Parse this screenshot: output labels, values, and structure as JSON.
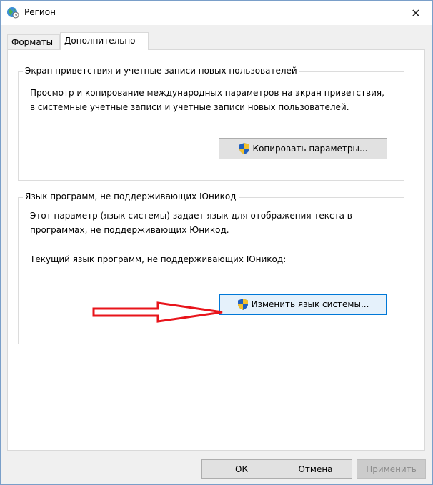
{
  "window": {
    "title": "Регион",
    "close_glyph": "✕"
  },
  "tabs": [
    {
      "label": "Форматы",
      "active": false
    },
    {
      "label": "Дополнительно",
      "active": true
    }
  ],
  "welcome_group": {
    "title": "Экран приветствия и учетные записи новых пользователей",
    "description_line1": "Просмотр и копирование международных параметров на экран приветствия,",
    "description_line2": "в системные учетные записи и учетные записи новых пользователей.",
    "button": {
      "label": "Копировать параметры...",
      "icon": "uac-shield-icon"
    }
  },
  "unicode_group": {
    "title": "Язык программ, не поддерживающих Юникод",
    "description_line1": "Этот параметр (язык системы) задает язык для отображения текста в",
    "description_line2": "программах, не поддерживающих Юникод.",
    "current_label": "Текущий язык программ, не поддерживающих Юникод:",
    "button": {
      "label": "Изменить язык системы...",
      "icon": "uac-shield-icon"
    }
  },
  "footer": {
    "ok_label": "ОК",
    "cancel_label": "Отмена",
    "apply_label": "Применить"
  },
  "annotation": {
    "arrow_color": "#e8141b",
    "icon": "red-arrow-icon"
  },
  "colors": {
    "accent": "#0078d7",
    "frame": "#7a9fc9"
  }
}
